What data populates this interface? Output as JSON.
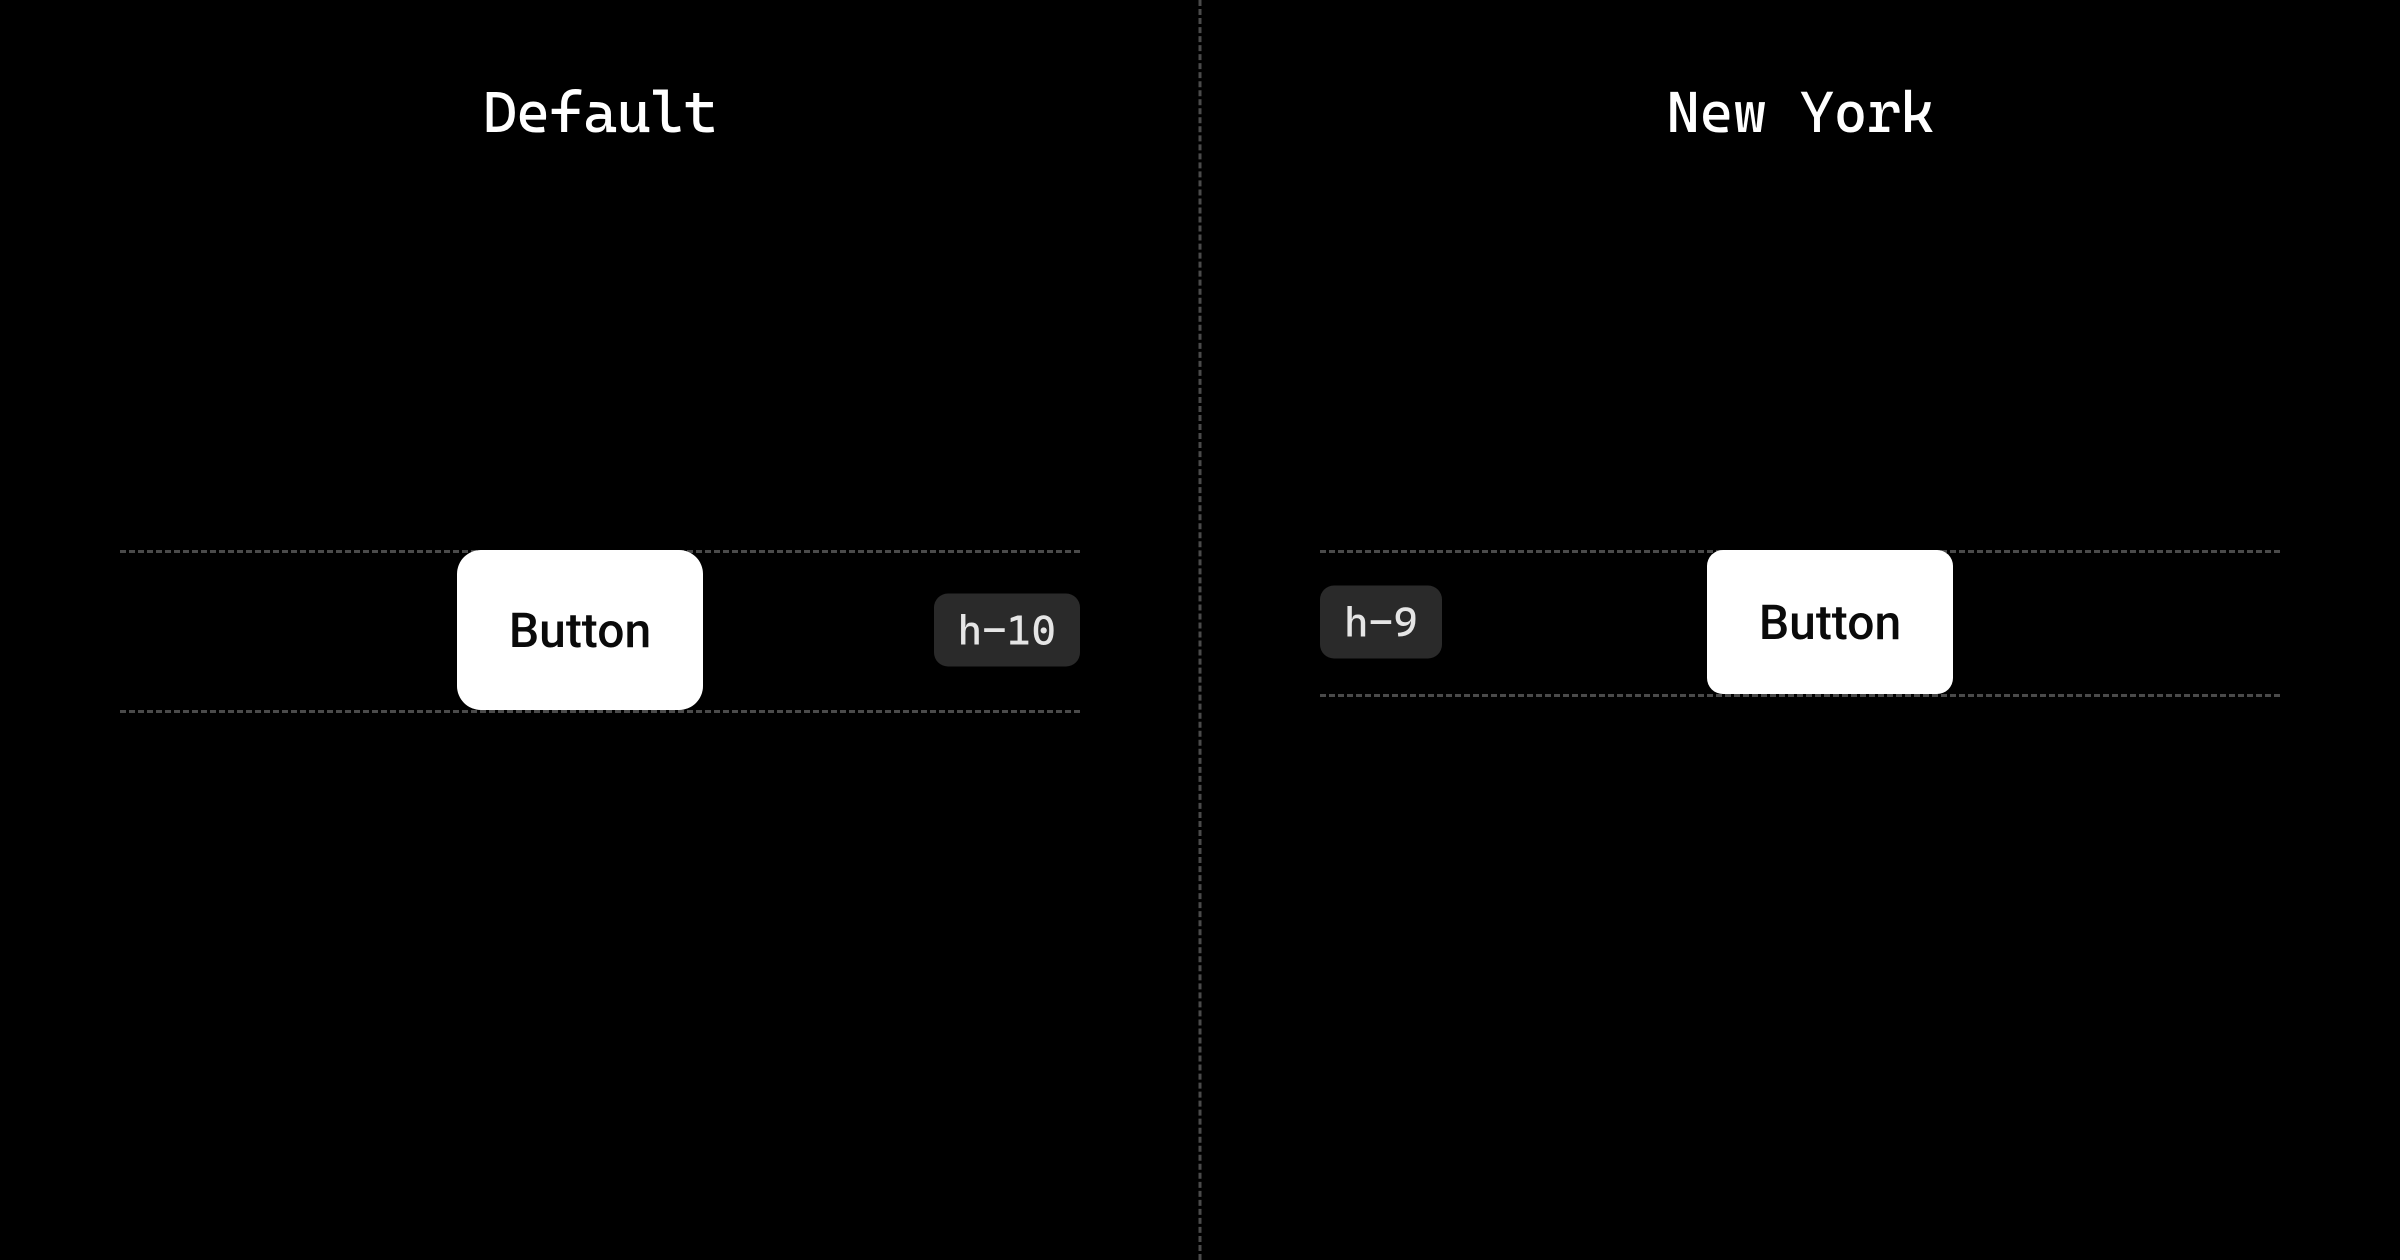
{
  "panels": {
    "left": {
      "title": "Default",
      "button_label": "Button",
      "height_badge": "h-10"
    },
    "right": {
      "title": "New York",
      "button_label": "Button",
      "height_badge": "h-9"
    }
  }
}
